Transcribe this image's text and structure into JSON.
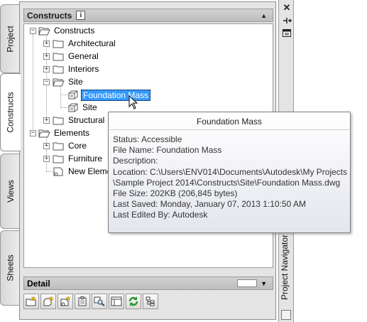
{
  "tabs": {
    "project": "Project",
    "constructs": "Constructs",
    "views": "Views",
    "sheets": "Sheets"
  },
  "palette": {
    "title": "Constructs",
    "info_icon": "info-icon",
    "detail_title": "Detail"
  },
  "tree": {
    "constructs": "Constructs",
    "architectural": "Architectural",
    "general": "General",
    "interiors": "Interiors",
    "site": "Site",
    "foundation_mass": "Foundation Mass",
    "site_child": "Site",
    "structural": "Structural",
    "elements": "Elements",
    "core": "Core",
    "furniture": "Furniture",
    "new_element": "New Eleme"
  },
  "tooltip": {
    "title": "Foundation Mass",
    "status": "Status: Accessible",
    "file_name": "File Name: Foundation Mass",
    "description": "Description:",
    "location_1": "Location: C:\\Users\\ENV014\\Documents\\Autodesk\\My Projects",
    "location_2": "\\Sample Project 2014\\Constructs\\Site\\Foundation Mass.dwg",
    "file_size": "File Size: 202KB (206,845 bytes)",
    "last_saved": "Last Saved: Monday, January 07, 2013  1:10:50 AM",
    "last_edited": "Last Edited By: Autodesk"
  },
  "right_strip": {
    "navigator_label": "Project Navigator",
    "close_icon": "close-icon",
    "autohide_icon": "auto-hide-icon",
    "properties_icon": "properties-icon"
  },
  "toolbar_icons": [
    "add-category-icon",
    "add-construct-icon",
    "add-element-icon",
    "clipboard-icon",
    "search-icon",
    "attach-icon",
    "refresh-icon",
    "repath-icon"
  ],
  "colors": {
    "selection": "#3399ff",
    "tooltip_border": "#7b7b7b"
  }
}
